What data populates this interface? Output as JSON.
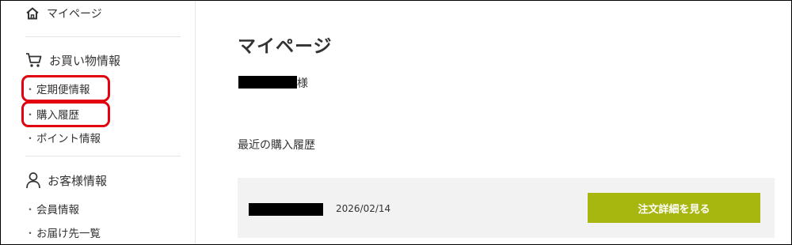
{
  "sidebar": {
    "mypage_label": "マイページ",
    "shopping": {
      "heading": "お買い物情報",
      "items": [
        {
          "label": "定期便情報"
        },
        {
          "label": "購入履歴"
        },
        {
          "label": "ポイント情報"
        }
      ]
    },
    "customer": {
      "heading": "お客様情報",
      "items": [
        {
          "label": "会員情報"
        },
        {
          "label": "お届け先一覧"
        }
      ]
    },
    "bullet": "・"
  },
  "main": {
    "title": "マイページ",
    "honorific": "様",
    "recent_heading": "最近の購入履歴",
    "order": {
      "date": "2026/02/14",
      "detail_button": "注文詳細を見る"
    }
  },
  "colors": {
    "accent_button": "#a8b70f",
    "highlight_outline": "#e3000f",
    "card_background": "#f2f2f2"
  },
  "icons": [
    "home-icon",
    "cart-icon",
    "person-icon"
  ]
}
